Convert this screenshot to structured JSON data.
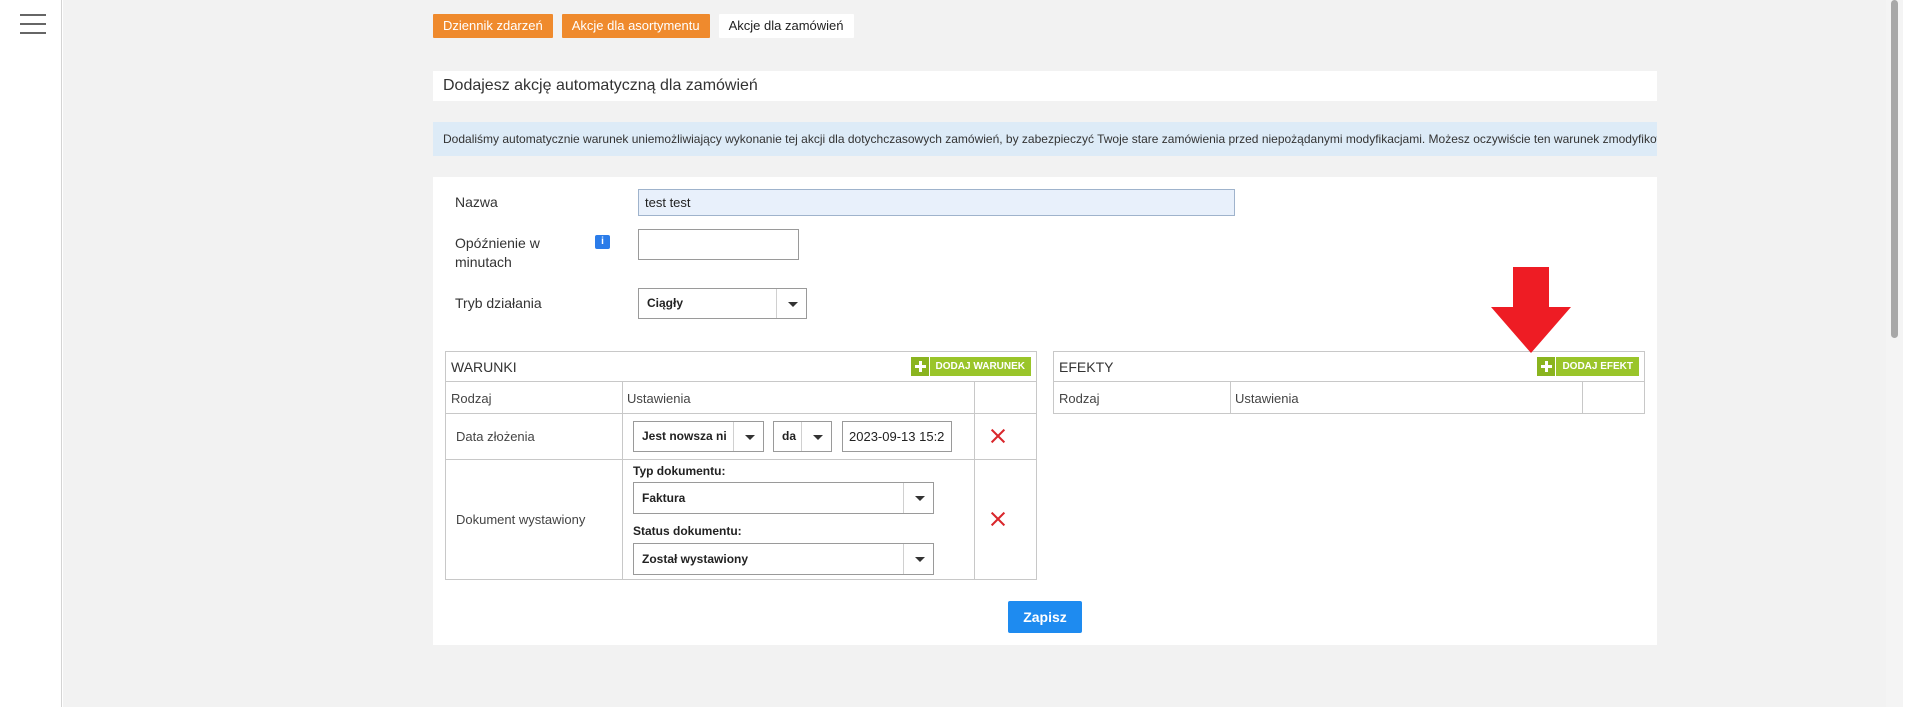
{
  "tabs": [
    {
      "label": "Dziennik zdarzeń",
      "style": "orange"
    },
    {
      "label": "Akcje dla asortymentu",
      "style": "orange"
    },
    {
      "label": "Akcje dla zamówień",
      "style": "active"
    }
  ],
  "page_title": "Dodajesz akcję automatyczną dla zamówień",
  "info_message": "Dodaliśmy automatycznie warunek uniemożliwiający wykonanie tej akcji dla dotychczasowych zamówień, by zabezpieczyć Twoje stare zamówienia przed niepożądanymi modyfikacjami. Możesz oczywiście ten warunek zmodyfikować lub usunąć.",
  "form": {
    "name_label": "Nazwa",
    "name_value": "test test",
    "delay_label": "Opóźnienie w minutach",
    "delay_value": "",
    "mode_label": "Tryb działania",
    "mode_value": "Ciągły",
    "info_icon": "i"
  },
  "conditions": {
    "title": "WARUNKI",
    "add_label": "DODAJ WARUNEK",
    "col_type": "Rodzaj",
    "col_settings": "Ustawienia",
    "rows": [
      {
        "type": "Data złożenia",
        "operator": "Jest nowsza ni",
        "unit": "da",
        "date": "2023-09-13 15:2"
      },
      {
        "type": "Dokument wystawiony",
        "doc_type_label": "Typ dokumentu:",
        "doc_type_value": "Faktura",
        "doc_status_label": "Status dokumentu:",
        "doc_status_value": "Został wystawiony"
      }
    ]
  },
  "effects": {
    "title": "EFEKTY",
    "add_label": "DODAJ EFEKT",
    "col_type": "Rodzaj",
    "col_settings": "Ustawienia"
  },
  "save_label": "Zapisz",
  "colors": {
    "orange_tab": "#ef8a2d",
    "add_green": "#9ac52a",
    "save_blue": "#1e8bf0",
    "delete_red": "#d9262b",
    "arrow_red": "#ee1c24",
    "info_bg": "#ddebf7"
  },
  "icons": {
    "menu": "hamburger-icon",
    "info": "info-icon",
    "add": "plus-icon",
    "delete": "close-x-icon",
    "dropdown": "caret-down-icon",
    "annotation": "red-arrow-down"
  }
}
